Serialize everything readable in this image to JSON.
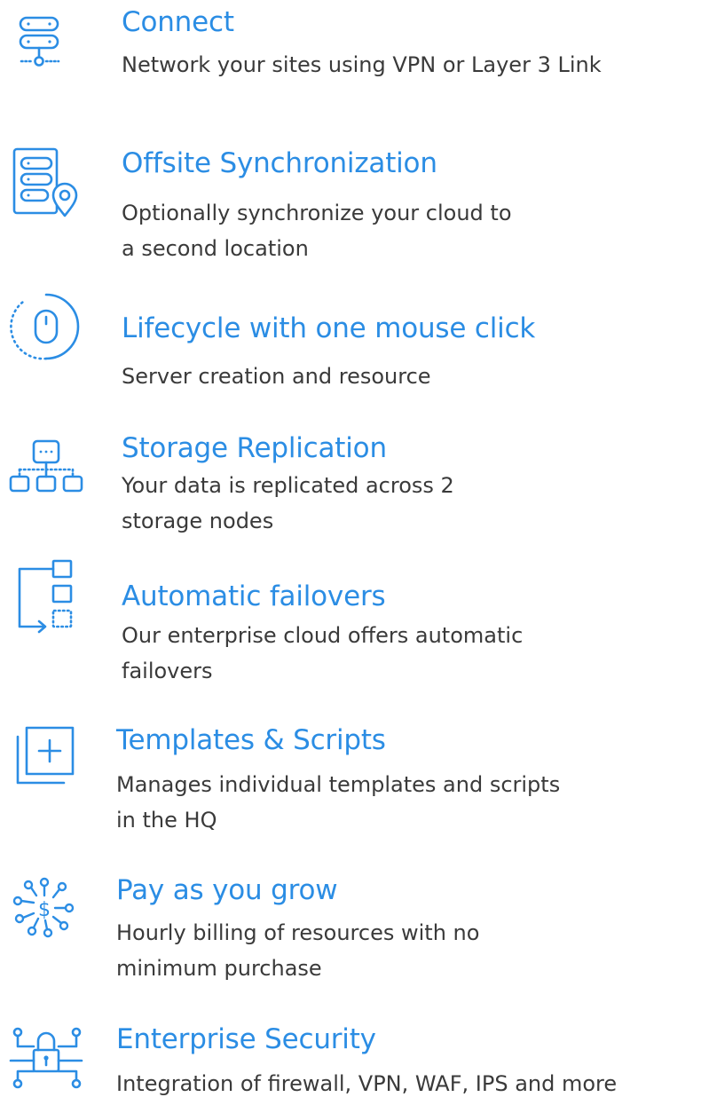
{
  "colors": {
    "accent": "#2b8de4",
    "text": "#3a3a3a"
  },
  "features": [
    {
      "icon": "server-network-icon",
      "title": "Connect",
      "desc_lines": [
        "Network your sites using VPN or Layer 3 Link"
      ]
    },
    {
      "icon": "server-location-icon",
      "title": "Offsite Synchronization",
      "desc_lines": [
        "Optionally synchronize your cloud to",
        "a second location"
      ]
    },
    {
      "icon": "mouse-cycle-icon",
      "title": "Lifecycle with one mouse click",
      "desc_lines": [
        "Server creation and resource"
      ]
    },
    {
      "icon": "hierarchy-nodes-icon",
      "title": "Storage Replication",
      "desc_lines": [
        "Your data is replicated across 2",
        "storage nodes"
      ]
    },
    {
      "icon": "failover-blocks-icon",
      "title": "Automatic failovers",
      "desc_lines": [
        "Our enterprise cloud offers automatic",
        "failovers"
      ]
    },
    {
      "icon": "template-add-icon",
      "title": "Templates & Scripts",
      "desc_lines": [
        "Manages individual templates and scripts",
        "in the HQ"
      ]
    },
    {
      "icon": "dollar-network-icon",
      "title": "Pay as you grow",
      "desc_lines": [
        "Hourly billing of resources with no",
        "minimum purchase"
      ]
    },
    {
      "icon": "security-lock-icon",
      "title": "Enterprise Security",
      "desc_lines": [
        "Integration of firewall, VPN, WAF, IPS and more"
      ]
    }
  ]
}
